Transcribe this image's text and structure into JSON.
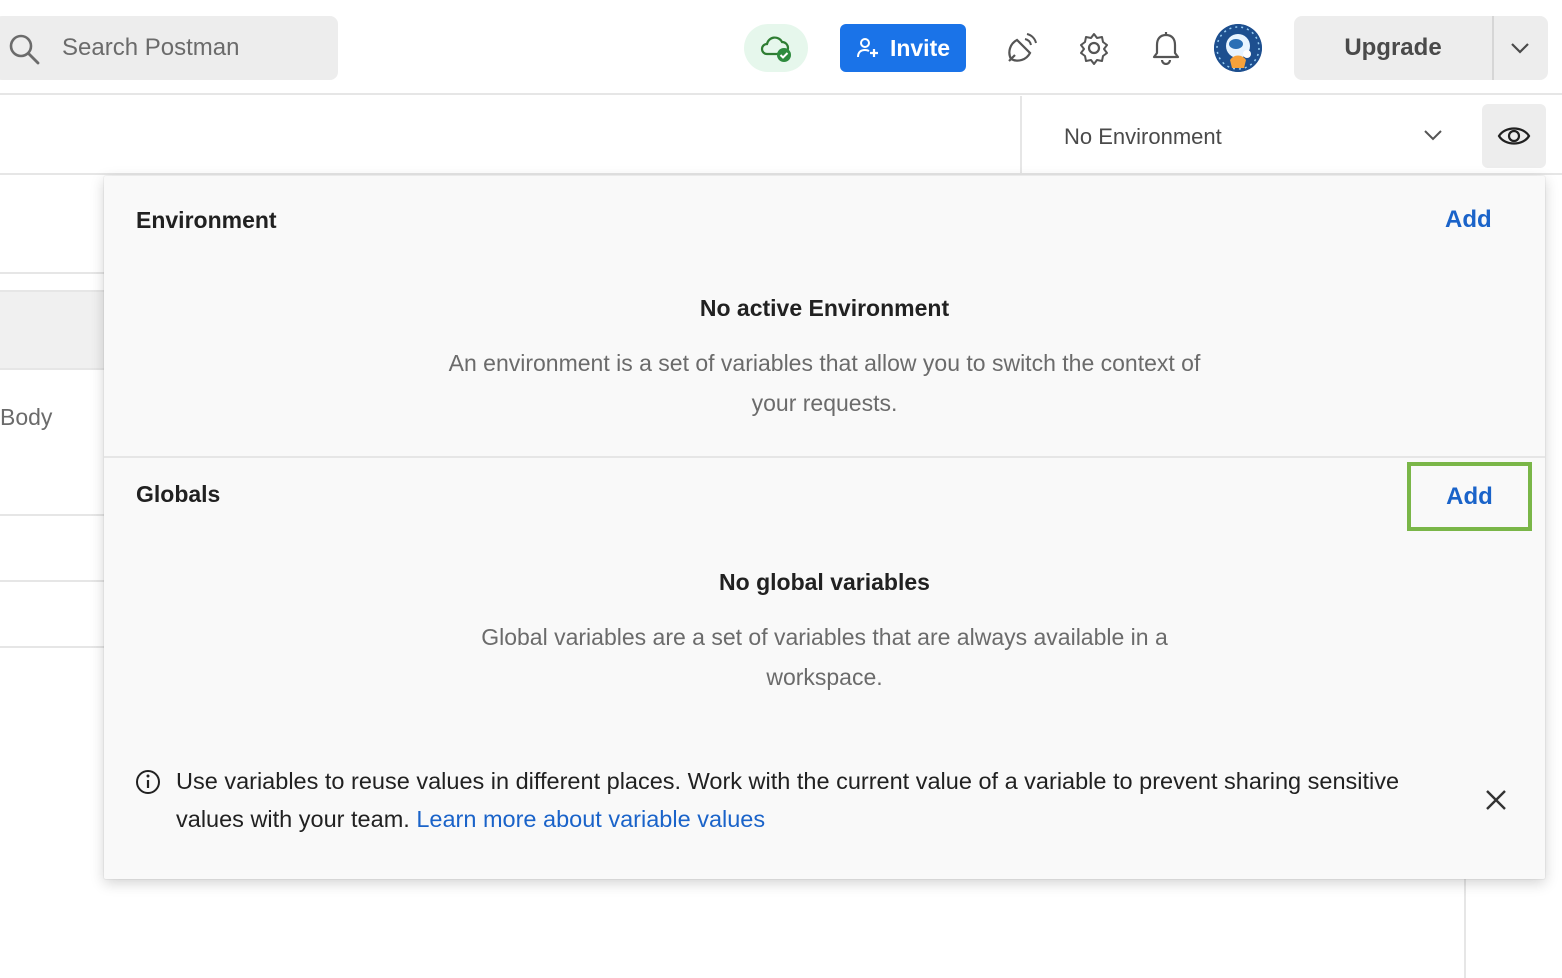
{
  "topbar": {
    "search_placeholder": "Search Postman",
    "invite_label": "Invite",
    "upgrade_label": "Upgrade",
    "accent": "#1a73e8"
  },
  "env_selector": {
    "value": "No Environment"
  },
  "background": {
    "body_tab_fragment": "Body"
  },
  "popover": {
    "environment": {
      "title": "Environment",
      "add_label": "Add",
      "empty_title": "No active Environment",
      "empty_desc": "An environment is a set of variables that allow you to switch the context of your requests."
    },
    "globals": {
      "title": "Globals",
      "add_label": "Add",
      "empty_title": "No global variables",
      "empty_desc": "Global variables are a set of variables that are always available in a workspace."
    },
    "info": {
      "text": "Use variables to reuse values in different places. Work with the current value of a variable to prevent sharing sensitive values with your team.",
      "link": "Learn more about variable values"
    },
    "highlight_color": "#7ab648"
  }
}
